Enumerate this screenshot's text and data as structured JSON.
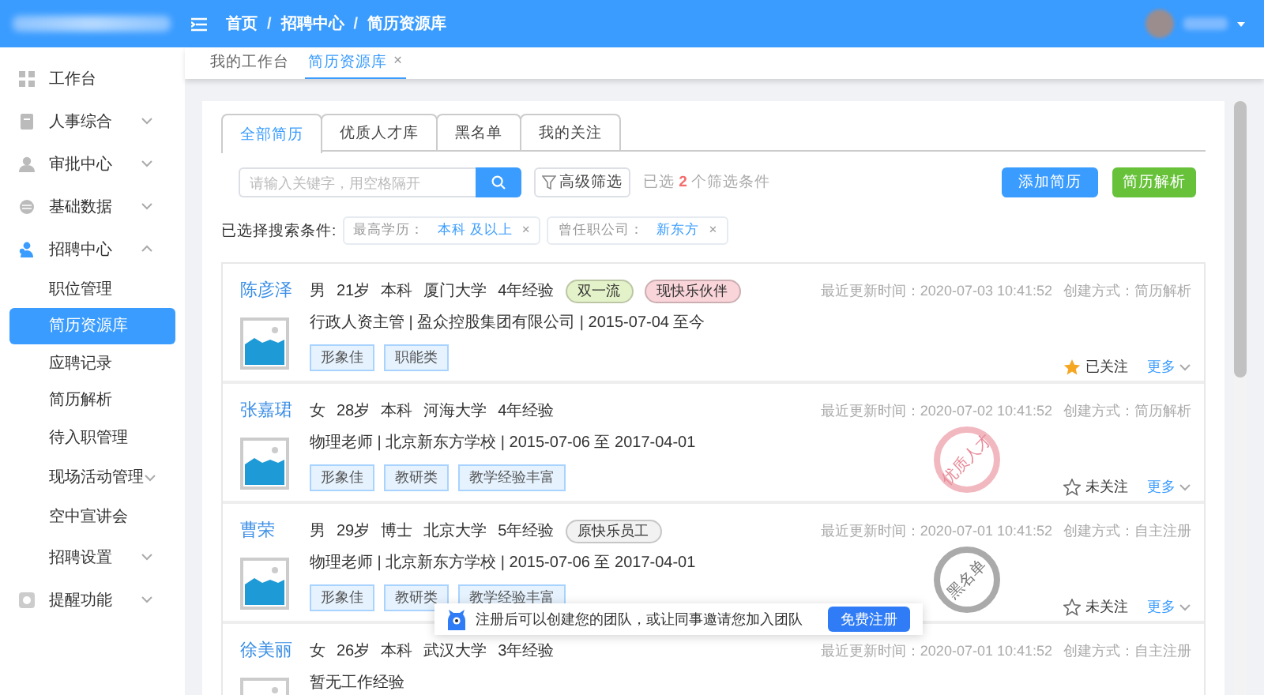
{
  "header": {
    "breadcrumb": [
      "首页",
      "招聘中心",
      "简历资源库"
    ],
    "separator": "/"
  },
  "sidebar": {
    "items": [
      {
        "label": "工作台",
        "kind": "link"
      },
      {
        "label": "人事综合",
        "kind": "menu",
        "expanded": false
      },
      {
        "label": "审批中心",
        "kind": "menu",
        "expanded": false
      },
      {
        "label": "基础数据",
        "kind": "menu",
        "expanded": false
      },
      {
        "label": "招聘中心",
        "kind": "menu",
        "expanded": true,
        "children": [
          {
            "label": "职位管理",
            "kind": "link",
            "selected": false
          },
          {
            "label": "简历资源库",
            "kind": "link",
            "selected": true
          },
          {
            "label": "应聘记录",
            "kind": "link",
            "selected": false
          },
          {
            "label": "简历解析",
            "kind": "link",
            "selected": false
          },
          {
            "label": "待入职管理",
            "kind": "link",
            "selected": false
          },
          {
            "label": "现场活动管理",
            "kind": "menu",
            "expanded": false
          },
          {
            "label": "空中宣讲会",
            "kind": "link",
            "selected": false
          },
          {
            "label": "招聘设置",
            "kind": "menu",
            "expanded": false
          }
        ]
      },
      {
        "label": "提醒功能",
        "kind": "menu",
        "expanded": false
      }
    ]
  },
  "page_tabs": [
    {
      "label": "我的工作台",
      "selected": false
    },
    {
      "label": "简历资源库",
      "selected": true,
      "close": "×"
    }
  ],
  "resume_tabs": [
    {
      "label": "全部简历",
      "selected": true
    },
    {
      "label": "优质人才库",
      "selected": false
    },
    {
      "label": "黑名单",
      "selected": false
    },
    {
      "label": "我的关注",
      "selected": false
    }
  ],
  "search": {
    "placeholder": "请输入关键字，用空格隔开",
    "advanced": "高级筛选",
    "summary": "已选 **2** 个筛选条件"
  },
  "actions": [
    {
      "label": "添加简历",
      "kind": "primary"
    },
    {
      "label": "简历解析",
      "kind": "success"
    }
  ],
  "filters": {
    "label": "已选择搜索条件:",
    "chips": [
      {
        "name": "最高学历：",
        "value": "本科 及以上",
        "close": "×"
      },
      {
        "name": "曾任职公司：",
        "value": "新东方",
        "close": "×"
      }
    ]
  },
  "candidates": [
    {
      "name": "陈彦泽",
      "info": [
        "男",
        "21岁",
        "本科",
        "厦门大学",
        "4年经验"
      ],
      "badges": [
        {
          "label": "双一流",
          "color": "#e4f2c9"
        },
        {
          "label": "现快乐伙伴",
          "color": "#f9d5d9"
        }
      ],
      "work": "行政人资主管 | 盈众控股集团有限公司 | 2015-07-04 至今",
      "tags": [
        "形象佳",
        "职能类"
      ],
      "updated": "最近更新时间：2020-07-03 10:41:52",
      "source": "创建方式：简历解析",
      "followed": true,
      "follow_label": "已关注",
      "more": "更多"
    },
    {
      "name": "张嘉珺",
      "info": [
        "女",
        "28岁",
        "本科",
        "河海大学",
        "4年经验"
      ],
      "work": "物理老师 | 北京新东方学校 | 2015-07-06 至 2017-04-01",
      "tags": [
        "形象佳",
        "教研类",
        "教学经验丰富"
      ],
      "updated": "最近更新时间：2020-07-02 10:41:52",
      "source": "创建方式：简历解析",
      "stamp": {
        "kind": "talent",
        "label": "优质人才"
      },
      "followed": false,
      "follow_label": "未关注",
      "more": "更多"
    },
    {
      "name": "曹荣",
      "info": [
        "男",
        "29岁",
        "博士",
        "北京大学",
        "5年经验"
      ],
      "badges": [
        {
          "label": "原快乐员工",
          "color": "#f2f2f2"
        }
      ],
      "work": "物理老师 | 北京新东方学校 | 2015-07-06 至 2017-04-01",
      "tags": [
        "形象佳",
        "教研类",
        "教学经验丰富"
      ],
      "updated": "最近更新时间：2020-07-01 10:41:52",
      "source": "创建方式：自主注册",
      "stamp": {
        "kind": "blacklist",
        "label": "黑名单"
      },
      "followed": false,
      "follow_label": "未关注",
      "more": "更多"
    },
    {
      "name": "徐美丽",
      "info": [
        "女",
        "26岁",
        "本科",
        "武汉大学",
        "3年经验"
      ],
      "work": "暂无工作经验",
      "updated": "最近更新时间：2020-07-01 10:41:52",
      "source": "创建方式：自主注册"
    }
  ],
  "toast": {
    "text": "注册后可以创建您的团队，或让同事邀请您加入团队",
    "button": "免费注册"
  }
}
